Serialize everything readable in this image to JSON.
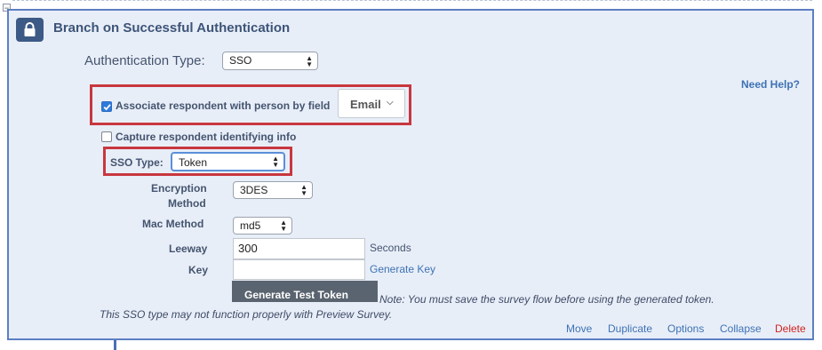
{
  "block": {
    "title": "Branch on Successful Authentication",
    "icon": "lock-icon"
  },
  "auth_type": {
    "label": "Authentication Type:",
    "value": "SSO"
  },
  "need_help": "Need Help?",
  "associate": {
    "checked": true,
    "label": "Associate respondent with person by field",
    "field_value": "Email"
  },
  "capture": {
    "checked": false,
    "label": "Capture respondent identifying info"
  },
  "sso_type": {
    "label": "SSO Type:",
    "value": "Token"
  },
  "encryption": {
    "label_line1": "Encryption",
    "label_line2": "Method",
    "value": "3DES"
  },
  "mac": {
    "label": "Mac Method",
    "value": "md5"
  },
  "leeway": {
    "label": "Leeway",
    "value": "300",
    "unit": "Seconds"
  },
  "key": {
    "label": "Key",
    "value": "",
    "generate_link": "Generate Key"
  },
  "generate_test_token": "Generate Test Token",
  "notes": {
    "save_note": "Note: You must save the survey flow before using the generated token.",
    "preview_note": "This SSO type may not function properly with Preview Survey."
  },
  "footer": {
    "move": "Move",
    "duplicate": "Duplicate",
    "options": "Options",
    "collapse": "Collapse",
    "delete": "Delete"
  },
  "colors": {
    "panel_bg": "#e8eef8",
    "panel_border": "#5c7fc2",
    "highlight": "#c8373f",
    "link": "#3d72b4",
    "delete": "#d0231f"
  }
}
